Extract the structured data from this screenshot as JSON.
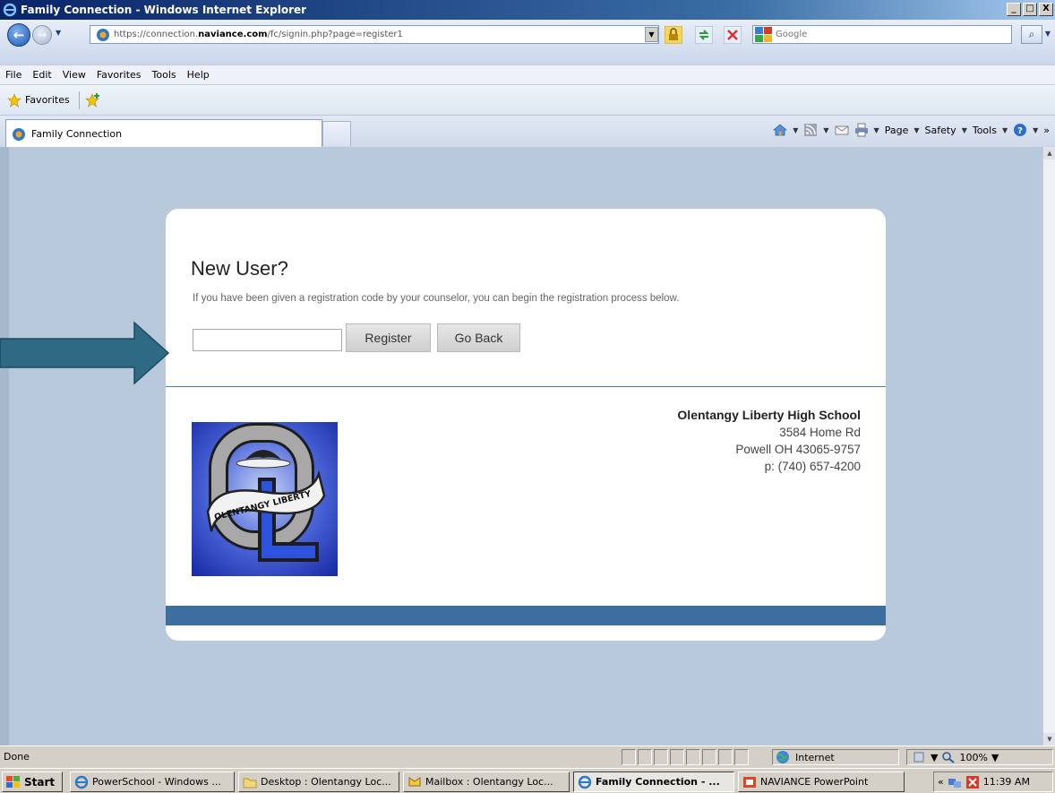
{
  "window": {
    "title": "Family Connection - Windows Internet Explorer",
    "controls": [
      "_",
      "□",
      "X"
    ]
  },
  "address_bar": {
    "url_prefix": "https://connection.",
    "url_domain": "naviance.com",
    "url_suffix": "/fc/signin.php?page=register1"
  },
  "search": {
    "placeholder": "Google"
  },
  "menu": [
    "File",
    "Edit",
    "View",
    "Favorites",
    "Tools",
    "Help"
  ],
  "favorites_bar": {
    "label": "Favorites"
  },
  "tab": {
    "label": "Family Connection"
  },
  "command_bar": {
    "page_label": "Page",
    "safety_label": "Safety",
    "tools_label": "Tools",
    "overflow": "»"
  },
  "page": {
    "heading": "New User?",
    "intro": "If you have been given a registration code by your counselor, you can begin the registration process below.",
    "code_value": "",
    "register_label": "Register",
    "go_back_label": "Go Back",
    "school": {
      "name": "Olentangy Liberty High School",
      "address1": "3584 Home Rd",
      "address2": "Powell OH 43065-9757",
      "phone": "p: (740) 657-4200"
    },
    "logo_banner_text": "OLENTANGY LIBERTY"
  },
  "status_bar": {
    "status": "Done",
    "zone": "Internet",
    "zoom": "100%"
  },
  "taskbar": {
    "start_label": "Start",
    "tasks": [
      "PowerSchool - Windows ...",
      "Desktop : Olentangy Loc...",
      "Mailbox : Olentangy Loc...",
      "Family Connection - ...",
      "NAVIANCE PowerPoint"
    ],
    "clock": "11:39 AM",
    "tray_expand": "«"
  },
  "colors": {
    "page_background": "#b8c9dc",
    "accent_bar": "#3c6e9f",
    "annotation_arrow": "#2f6a85"
  }
}
